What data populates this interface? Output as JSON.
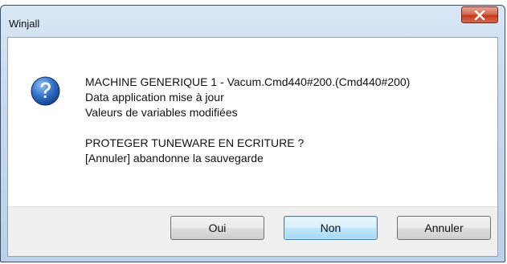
{
  "window": {
    "title": "Winjall"
  },
  "message": {
    "lines": [
      "MACHINE GENERIQUE 1 - Vacum.Cmd440#200.(Cmd440#200)",
      "Data application mise à jour",
      "Valeurs de variables modifiées",
      "",
      "PROTEGER TUNEWARE EN ECRITURE ?",
      "[Annuler] abandonne la sauvegarde"
    ]
  },
  "buttons": {
    "yes_label": "Oui",
    "no_label": "Non",
    "cancel_label": "Annuler"
  },
  "icons": {
    "message_icon": "question-icon",
    "close_icon": "close-icon"
  },
  "colors": {
    "close_button": "#c2391d",
    "question_icon": "#1f5fb8",
    "default_button_border": "#3c7fb1"
  }
}
